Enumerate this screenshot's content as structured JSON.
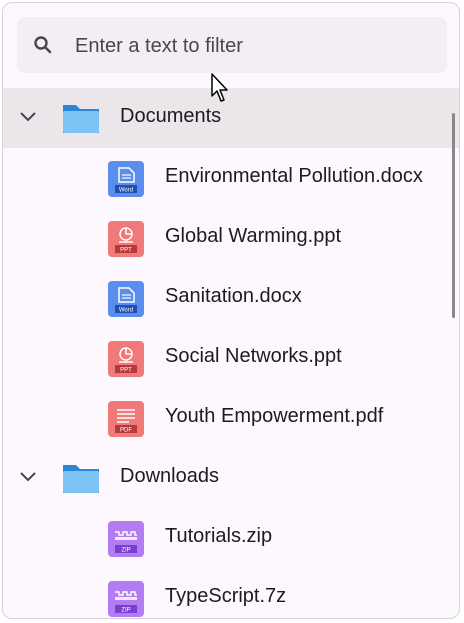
{
  "search": {
    "placeholder": "Enter a text to filter",
    "value": ""
  },
  "tree": {
    "folders": [
      {
        "name": "Documents",
        "expanded": true,
        "files": [
          {
            "name": "Environmental Pollution.docx",
            "type": "word",
            "badge": "Word"
          },
          {
            "name": "Global Warming.ppt",
            "type": "ppt",
            "badge": "PPT"
          },
          {
            "name": "Sanitation.docx",
            "type": "word",
            "badge": "Word"
          },
          {
            "name": "Social Networks.ppt",
            "type": "ppt",
            "badge": "PPT"
          },
          {
            "name": "Youth Empowerment.pdf",
            "type": "pdf",
            "badge": "PDF"
          }
        ]
      },
      {
        "name": "Downloads",
        "expanded": true,
        "files": [
          {
            "name": "Tutorials.zip",
            "type": "zip",
            "badge": "ZIP"
          },
          {
            "name": "TypeScript.7z",
            "type": "zip",
            "badge": "ZIP"
          }
        ]
      }
    ]
  },
  "icons": {
    "search": "search-icon",
    "chevron": "chevron-down-icon",
    "folder": "folder-icon",
    "word": "word-file-icon",
    "ppt": "ppt-file-icon",
    "pdf": "pdf-file-icon",
    "zip": "zip-file-icon"
  },
  "colors": {
    "word": "#5b8def",
    "ppt": "#f07a7a",
    "pdf": "#f07a7a",
    "zip": "#b27cf2",
    "folder": "#7cc4f5",
    "selected_row": "#ebe6ea"
  }
}
